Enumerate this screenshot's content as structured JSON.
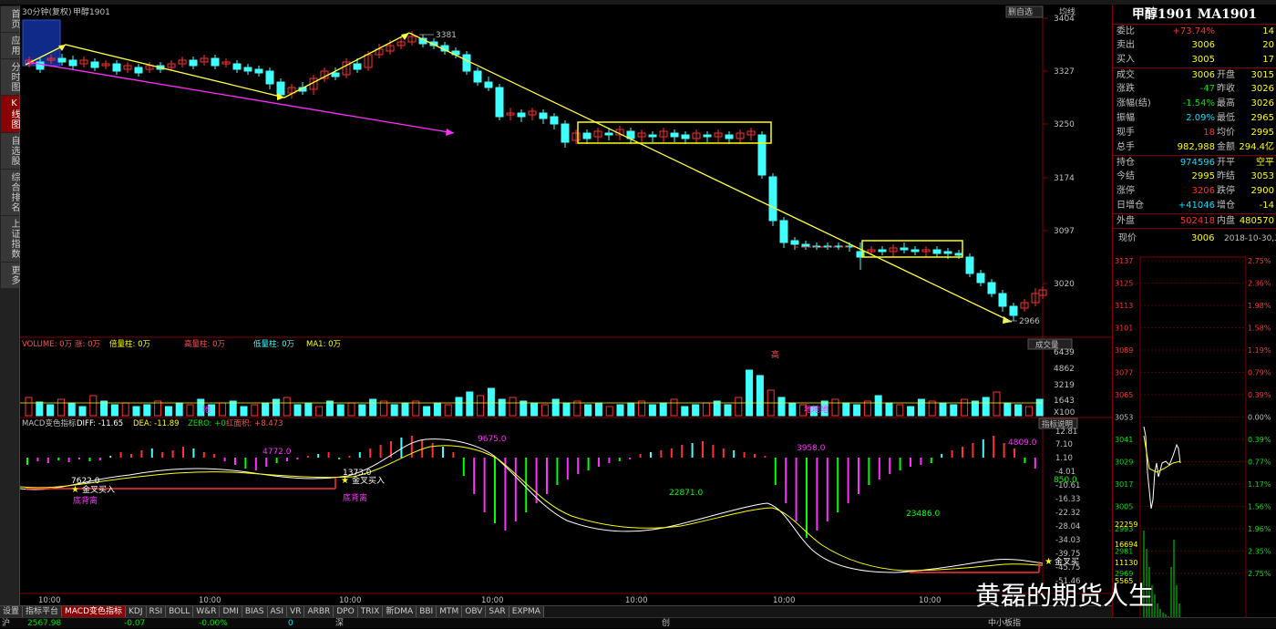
{
  "header": {
    "period": "30分钟(复权)",
    "symbol": "甲醇1901",
    "btn_right": "删自选",
    "btn_avg": "均线"
  },
  "left_tabs": [
    {
      "label": "首页",
      "active": false
    },
    {
      "label": "应用",
      "active": false
    },
    {
      "label": "分时图",
      "active": false
    },
    {
      "label": "K线图",
      "active": true
    },
    {
      "label": "自选股",
      "active": false
    },
    {
      "label": "综合排名",
      "active": false
    },
    {
      "label": "上证指数",
      "active": false
    },
    {
      "label": "更多",
      "active": false
    }
  ],
  "price_axis": [
    "3404",
    "3327",
    "3250",
    "3174",
    "3097",
    "3020"
  ],
  "price_labels": {
    "high": "3381",
    "low": "2966"
  },
  "volume_header": {
    "volume": "VOLUME: 0万",
    "rise": "涨: 0万",
    "fall": "降: 0万",
    "double": "倍量柱: 0万",
    "high_vol": "高量柱: 0万",
    "low_vol": "低量柱: 0万",
    "ma": "MA1: 0万",
    "btn": "成交量"
  },
  "volume_axis": [
    "6439",
    "4862",
    "3219",
    "1643",
    "X100"
  ],
  "vol_marks": {
    "high": "高",
    "low1": "地",
    "low2": "地地地"
  },
  "macd_header": {
    "name": "MACD变色指标",
    "diff": "DIFF: -11.65",
    "dea": "DEA: -11.89",
    "zero": "ZERO: +0",
    "red": "红面积: +8.473",
    "btn": "指标说明"
  },
  "macd_axis": [
    "12.81",
    "7.10",
    "1.10",
    "-4.01",
    "-10.61",
    "-16.33",
    "-22.32",
    "-28.04",
    "-34.03",
    "-39.75",
    "-45.75",
    "-51.46"
  ],
  "macd_labels": [
    "7622.0",
    "4772.0",
    "1373.0",
    "9675.0",
    "3958.0",
    "22871.0",
    "23486.0",
    "4809.0",
    "850.0"
  ],
  "macd_signals": {
    "buy1": "金叉买入",
    "buy2": "金叉买入",
    "buy3": "金叉买",
    "bottom1": "底背离",
    "bottom2": "底背离"
  },
  "time_axis": [
    "10:00",
    "10:00",
    "10:00",
    "10:00",
    "10:00",
    "10:00",
    "10:00"
  ],
  "bottom_tabs": [
    {
      "label": "设置",
      "active": false
    },
    {
      "label": "指标平台",
      "active": false
    },
    {
      "label": "MACD变色指标",
      "active": true
    },
    {
      "label": "KDJ"
    },
    {
      "label": "RSI"
    },
    {
      "label": "BOLL"
    },
    {
      "label": "W&R"
    },
    {
      "label": "DMI"
    },
    {
      "label": "BIAS"
    },
    {
      "label": "ASI"
    },
    {
      "label": "VR"
    },
    {
      "label": "ARBR"
    },
    {
      "label": "DPO"
    },
    {
      "label": "TRIX"
    },
    {
      "label": "新DMA"
    },
    {
      "label": "BBI"
    },
    {
      "label": "MTM"
    },
    {
      "label": "OBV"
    },
    {
      "label": "SAR"
    },
    {
      "label": "EXPMA"
    }
  ],
  "quote": {
    "title": "甲醇1901 MA1901",
    "rows": [
      {
        "l1": "委比",
        "v1": "+73.74%",
        "c1": "#ff3030",
        "l2": "",
        "v2": "14"
      },
      {
        "l1": "卖出",
        "v1": "3006",
        "c1": "#ffff00",
        "l2": "",
        "v2": "20"
      },
      {
        "l1": "买入",
        "v1": "3005",
        "c1": "#ffff00",
        "l2": "",
        "v2": "17"
      },
      {
        "l1": "成交",
        "v1": "3006",
        "c1": "#ffff00",
        "l2": "开盘",
        "v2": "3015"
      },
      {
        "l1": "涨跌",
        "v1": "-47",
        "c1": "#00e000",
        "l2": "昨收",
        "v2": "3026"
      },
      {
        "l1": "涨幅(结)",
        "v1": "-1.54%",
        "c1": "#00e000",
        "l2": "最高",
        "v2": "3026"
      },
      {
        "l1": "振幅",
        "v1": "2.09%",
        "c1": "#00e0ff",
        "l2": "最低",
        "v2": "2965"
      },
      {
        "l1": "现手",
        "v1": "18",
        "c1": "#ff3030",
        "l2": "均价",
        "v2": "2995"
      },
      {
        "l1": "总手",
        "v1": "982,988",
        "c1": "#ffff00",
        "l2": "金额",
        "v2": "294.4亿"
      },
      {
        "l1": "持仓",
        "v1": "974596",
        "c1": "#00e0ff",
        "l2": "开平",
        "v2": "空平"
      },
      {
        "l1": "今结",
        "v1": "2995",
        "c1": "#ffff00",
        "l2": "昨结",
        "v2": "3053"
      },
      {
        "l1": "涨停",
        "v1": "3206",
        "c1": "#ff3030",
        "l2": "跌停",
        "v2": "2900"
      },
      {
        "l1": "日增仓",
        "v1": "+41046",
        "c1": "#00e0ff",
        "l2": "增仓",
        "v2": "-14"
      },
      {
        "l1": "外盘",
        "v1": "502418",
        "c1": "#ff3030",
        "l2": "内盘",
        "v2": "480570"
      }
    ],
    "price_now_label": "现价",
    "price_now": "3006",
    "date": "2018-10-30,二"
  },
  "mini_chart": {
    "prices": [
      "3137",
      "3125",
      "3113",
      "3101",
      "3089",
      "3077",
      "3065",
      "3053",
      "3041",
      "3029",
      "3017",
      "3005",
      "2993",
      "2981",
      "2969"
    ],
    "pcts": [
      "2.75%",
      "2.36%",
      "1.98%",
      "1.58%",
      "1.19%",
      "0.79%",
      "0.39%",
      "0.00%",
      "0.39%",
      "0.77%",
      "1.17%",
      "1.56%",
      "1.96%",
      "2.35%",
      "2.75%"
    ],
    "vols": [
      "22259",
      "16694",
      "11130",
      "5565"
    ]
  },
  "status": {
    "sh": "沪",
    "sh_val": "2567.98",
    "sh_chg": "-0.07",
    "sh_pct": "-0.00%",
    "sh_vol": "0",
    "sz": "深",
    "cy": "创",
    "zx": "中小板指"
  },
  "watermark": "黄磊的期货人生"
}
